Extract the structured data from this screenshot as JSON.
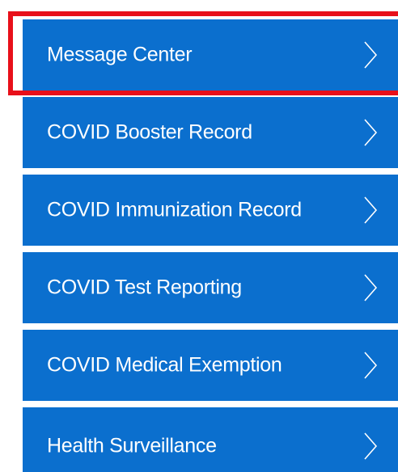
{
  "menu": {
    "items": [
      {
        "label": "Message Center",
        "icon": "chevron-right-icon"
      },
      {
        "label": "COVID Booster Record",
        "icon": "chevron-right-icon"
      },
      {
        "label": "COVID Immunization Record",
        "icon": "chevron-right-icon"
      },
      {
        "label": "COVID Test Reporting",
        "icon": "chevron-right-icon"
      },
      {
        "label": "COVID Medical Exemption",
        "icon": "chevron-right-icon"
      },
      {
        "label": "Health Surveillance",
        "icon": "chevron-right-icon"
      }
    ]
  },
  "colors": {
    "item_background": "#0b6fce",
    "item_text": "#ffffff",
    "highlight_border": "#e8101a",
    "page_background": "#ffffff"
  }
}
